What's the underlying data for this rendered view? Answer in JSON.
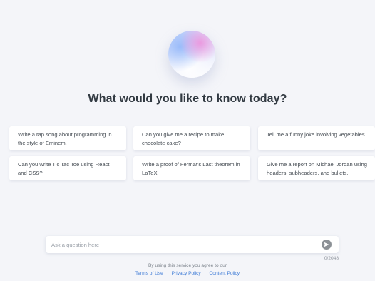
{
  "main": {
    "heading": "What would you like to know today?"
  },
  "suggestions": [
    {
      "text": "Write a rap song about programming in the style of Eminem."
    },
    {
      "text": "Can you give me a recipe to make chocolate cake?"
    },
    {
      "text": "Tell me a funny joke involving vegetables."
    },
    {
      "text": "Can you write Tic Tac Toe using React and CSS?"
    },
    {
      "text": "Write a proof of Fermat's Last theorem in LaTeX."
    },
    {
      "text": "Give me a report on Michael Jordan using headers, subheaders, and bullets."
    }
  ],
  "composer": {
    "placeholder": "Ask a question here",
    "value": "",
    "char_count": "0/2048",
    "send_icon": "send-arrow-icon"
  },
  "footer": {
    "disclaimer": "By using this service you agree to our",
    "links": [
      "Terms of Use",
      "Privacy Policy",
      "Content Policy"
    ],
    "link_color": "#3e7bd6"
  },
  "colors": {
    "background": "#f4f5f9",
    "heading": "#323a42",
    "send_button": "#8c9196"
  }
}
